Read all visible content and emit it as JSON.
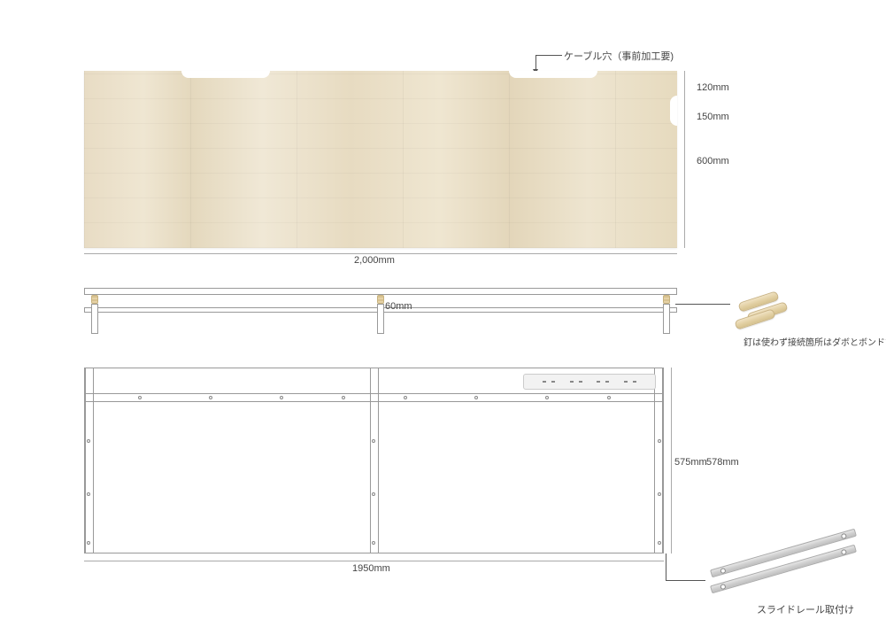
{
  "callouts": {
    "cable_hole": "ケーブル穴（事前加工要)",
    "dowel_note": "釘は使わず接続箇所はダボとボンドで接続",
    "slide_rail_note": "スライドレール取付け"
  },
  "dimensions": {
    "top_width": "2,000mm",
    "top_depth": "600mm",
    "notch_offset": "120mm",
    "notch_length": "150mm",
    "apron_height": "60mm",
    "frame_width": "1950mm",
    "frame_height_a": "575mm",
    "frame_height_b": "578mm"
  }
}
